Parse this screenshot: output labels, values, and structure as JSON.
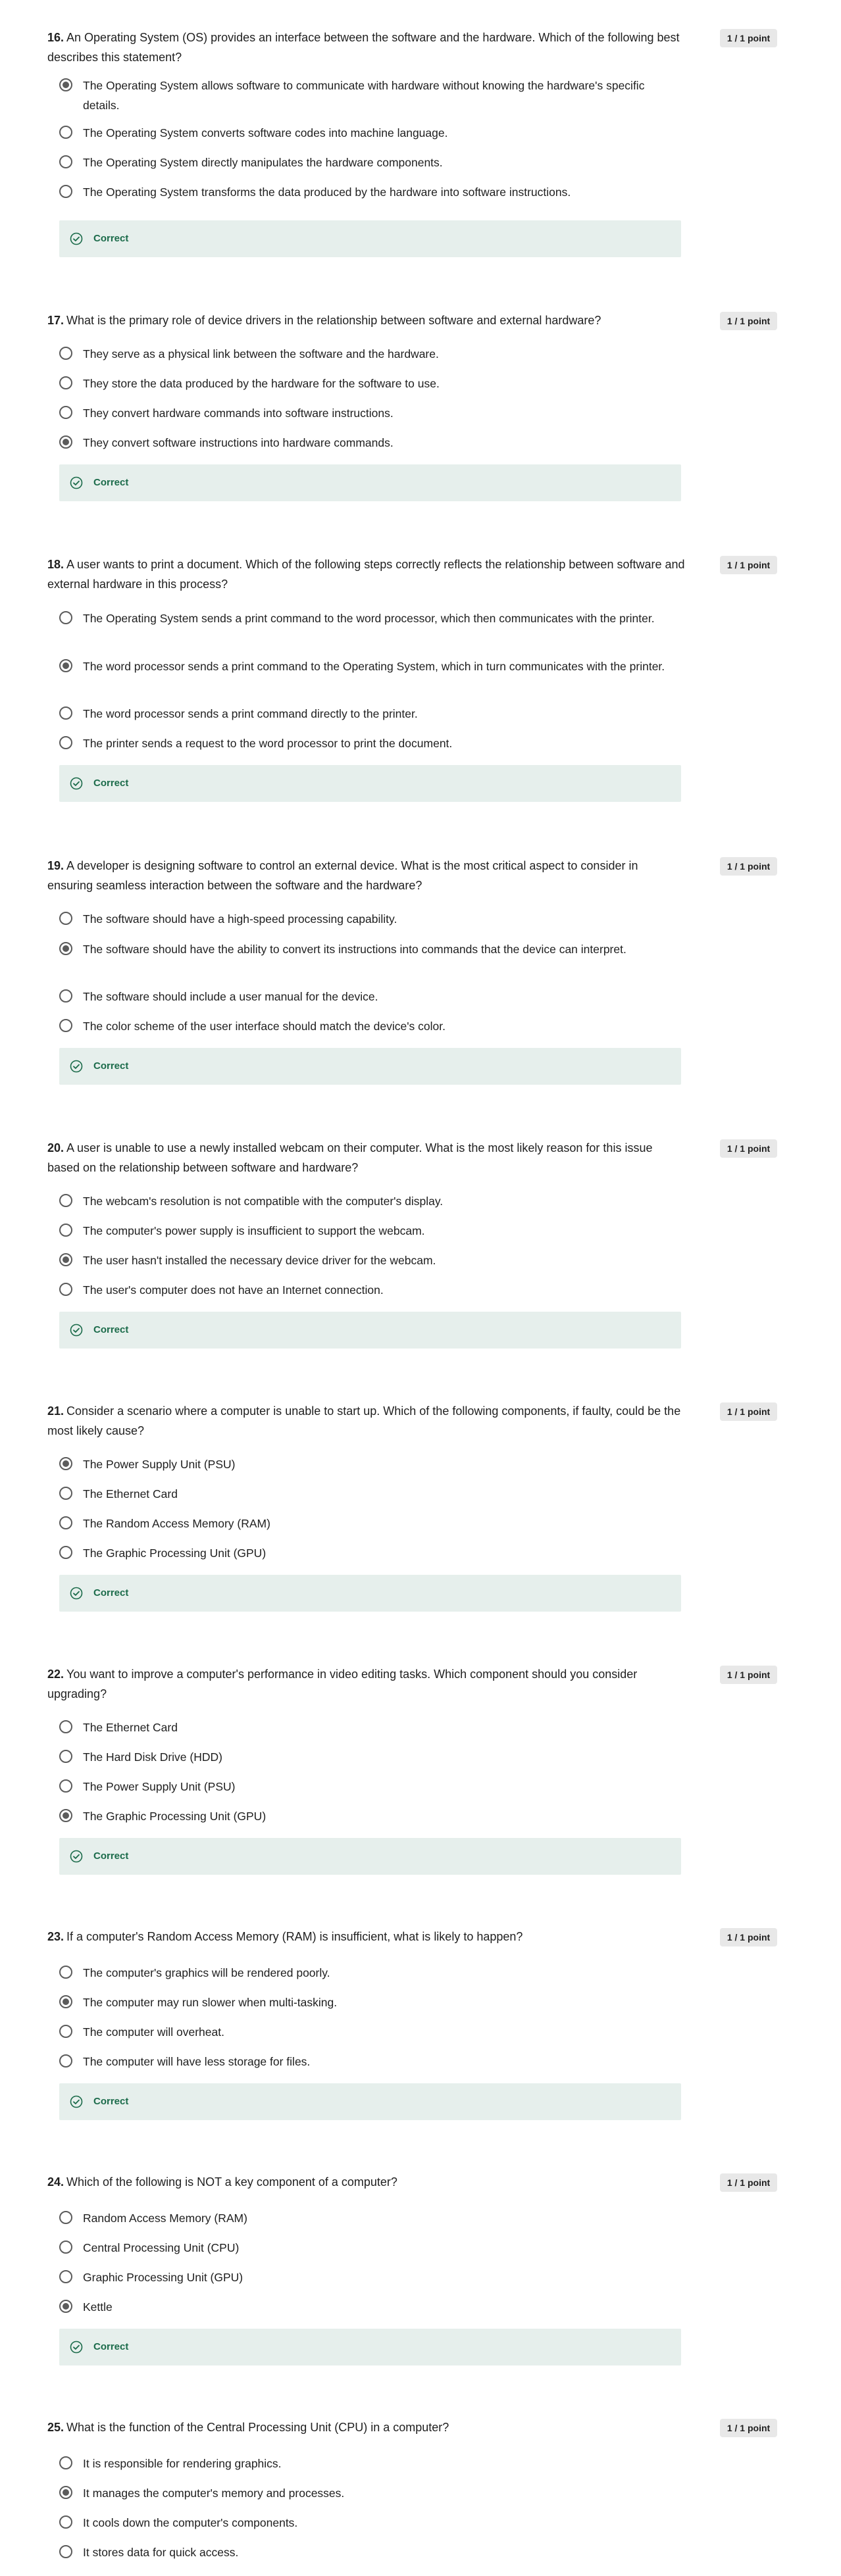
{
  "questions": [
    {
      "number": "16.",
      "text": "An Operating System (OS) provides an interface between the software and the hardware. Which of the following best describes this statement?",
      "points": "1 / 1 point",
      "options": [
        {
          "text": "The Operating System allows software to communicate with hardware without knowing the hardware's specific details.",
          "selected": true
        },
        {
          "text": "The Operating System converts software codes into machine language.",
          "selected": false
        },
        {
          "text": "The Operating System directly manipulates the hardware components.",
          "selected": false
        },
        {
          "text": "The Operating System transforms the data produced by the hardware into software instructions.",
          "selected": false
        }
      ],
      "feedback": "Correct"
    },
    {
      "number": "17.",
      "text": "What is the primary role of device drivers in the relationship between software and external hardware?",
      "points": "1 / 1 point",
      "options": [
        {
          "text": "They serve as a physical link between the software and the hardware.",
          "selected": false
        },
        {
          "text": "They store the data produced by the hardware for the software to use.",
          "selected": false
        },
        {
          "text": "They convert hardware commands into software instructions.",
          "selected": false
        },
        {
          "text": "They convert software instructions into hardware commands.",
          "selected": true
        }
      ],
      "feedback": "Correct"
    },
    {
      "number": "18.",
      "text": "A user wants to print a document. Which of the following steps correctly reflects the relationship between software and external hardware in this process?",
      "points": "1 / 1 point",
      "options": [
        {
          "text": "The Operating System sends a print command to the word processor, which then communicates with the printer.",
          "selected": false
        },
        {
          "text": "The word processor sends a print command to the Operating System, which in turn communicates with the printer.",
          "selected": true
        },
        {
          "text": "The word processor sends a print command directly to the printer.",
          "selected": false
        },
        {
          "text": "The printer sends a request to the word processor to print the document.",
          "selected": false
        }
      ],
      "feedback": "Correct"
    },
    {
      "number": "19.",
      "text": "A developer is designing software to control an external device. What is the most critical aspect to consider in ensuring seamless interaction between the software and the hardware?",
      "points": "1 / 1 point",
      "options": [
        {
          "text": "The software should have a high-speed processing capability.",
          "selected": false
        },
        {
          "text": "The software should have the ability to convert its instructions into commands that the device can interpret.",
          "selected": true
        },
        {
          "text": "The software should include a user manual for the device.",
          "selected": false
        },
        {
          "text": "The color scheme of the user interface should match the device's color.",
          "selected": false
        }
      ],
      "feedback": "Correct"
    },
    {
      "number": "20.",
      "text": "A user is unable to use a newly installed webcam on their computer. What is the most likely reason for this issue based on the relationship between software and hardware?",
      "points": "1 / 1 point",
      "options": [
        {
          "text": "The webcam's resolution is not compatible with the computer's display.",
          "selected": false
        },
        {
          "text": "The computer's power supply is insufficient to support the webcam.",
          "selected": false
        },
        {
          "text": "The user hasn't installed the necessary device driver for the webcam.",
          "selected": true
        },
        {
          "text": "The user's computer does not have an Internet connection.",
          "selected": false
        }
      ],
      "feedback": "Correct"
    },
    {
      "number": "21.",
      "text": "Consider a scenario where a computer is unable to start up. Which of the following components, if faulty, could be the most likely cause?",
      "points": "1 / 1 point",
      "options": [
        {
          "text": "The Power Supply Unit (PSU)",
          "selected": true
        },
        {
          "text": "The Ethernet Card",
          "selected": false
        },
        {
          "text": "The Random Access Memory (RAM)",
          "selected": false
        },
        {
          "text": "The Graphic Processing Unit (GPU)",
          "selected": false
        }
      ],
      "feedback": "Correct"
    },
    {
      "number": "22.",
      "text": "You want to improve a computer's performance in video editing tasks. Which component should you consider upgrading?",
      "points": "1 / 1 point",
      "options": [
        {
          "text": "The Ethernet Card",
          "selected": false
        },
        {
          "text": "The Hard Disk Drive (HDD)",
          "selected": false
        },
        {
          "text": "The Power Supply Unit (PSU)",
          "selected": false
        },
        {
          "text": "The Graphic Processing Unit (GPU)",
          "selected": true
        }
      ],
      "feedback": "Correct"
    },
    {
      "number": "23.",
      "text": "If a computer's Random Access Memory (RAM) is insufficient, what is likely to happen?",
      "points": "1 / 1 point",
      "options": [
        {
          "text": "The computer's graphics will be rendered poorly.",
          "selected": false
        },
        {
          "text": "The computer may run slower when multi-tasking.",
          "selected": true
        },
        {
          "text": "The computer will overheat.",
          "selected": false
        },
        {
          "text": "The computer will have less storage for files.",
          "selected": false
        }
      ],
      "feedback": "Correct"
    },
    {
      "number": "24.",
      "text": "Which of the following is NOT a key component of a computer?",
      "points": "1 / 1 point",
      "options": [
        {
          "text": "Random Access Memory (RAM)",
          "selected": false
        },
        {
          "text": "Central Processing Unit (CPU)",
          "selected": false
        },
        {
          "text": "Graphic Processing Unit (GPU)",
          "selected": false
        },
        {
          "text": "Kettle",
          "selected": true
        }
      ],
      "feedback": "Correct"
    },
    {
      "number": "25.",
      "text": "What is the function of the Central Processing Unit (CPU) in a computer?",
      "points": "1 / 1 point",
      "options": [
        {
          "text": "It is responsible for rendering graphics.",
          "selected": false
        },
        {
          "text": "It manages the computer's memory and processes.",
          "selected": true
        },
        {
          "text": "It cools down the computer's components.",
          "selected": false
        },
        {
          "text": "It stores data for quick access.",
          "selected": false
        }
      ],
      "feedback": null
    }
  ]
}
